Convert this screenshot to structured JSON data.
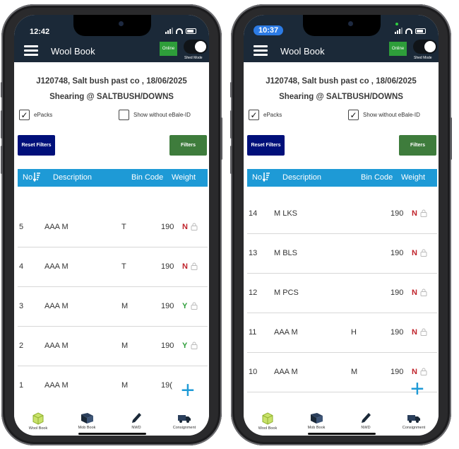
{
  "phones": [
    {
      "status": {
        "time": "12:42"
      },
      "app": {
        "title": "Wool Book",
        "online": "Online",
        "shed_mode": "Shed Mode"
      },
      "job": {
        "line1": "J120748, Salt bush past co , 18/06/2025",
        "line2": "Shearing @ SALTBUSH/DOWNS"
      },
      "filters": {
        "epacks_label": "ePacks",
        "epacks_checked": true,
        "without_ebale_label": "Show without eBale-ID",
        "without_ebale_checked": false,
        "reset_label": "Reset Filters",
        "filters_label": "Filters"
      },
      "table": {
        "headers": {
          "no": "No",
          "description": "Description",
          "bin_code": "Bin Code",
          "weight": "Weight"
        },
        "rows": [
          {
            "no": "5",
            "description": "AAA M",
            "bin": "T",
            "weight": "190",
            "flag": "N"
          },
          {
            "no": "4",
            "description": "AAA M",
            "bin": "T",
            "weight": "190",
            "flag": "N"
          },
          {
            "no": "3",
            "description": "AAA M",
            "bin": "M",
            "weight": "190",
            "flag": "Y"
          },
          {
            "no": "2",
            "description": "AAA M",
            "bin": "M",
            "weight": "190",
            "flag": "Y"
          },
          {
            "no": "1",
            "description": "AAA M",
            "bin": "M",
            "weight": "19(",
            "flag": ""
          }
        ]
      },
      "nav": [
        "Wool Book",
        "Mob Book",
        "NWD",
        "Consignment"
      ]
    },
    {
      "status": {
        "time": "10:37"
      },
      "app": {
        "title": "Wool Book",
        "online": "Online",
        "shed_mode": "Shed Mode"
      },
      "job": {
        "line1": "J120748, Salt bush past co , 18/06/2025",
        "line2": "Shearing @ SALTBUSH/DOWNS"
      },
      "filters": {
        "epacks_label": "ePacks",
        "epacks_checked": true,
        "without_ebale_label": "Show without eBale-ID",
        "without_ebale_checked": true,
        "reset_label": "Reset Filters",
        "filters_label": "Filters"
      },
      "table": {
        "headers": {
          "no": "No",
          "description": "Description",
          "bin_code": "Bin Code",
          "weight": "Weight"
        },
        "rows": [
          {
            "no": "14",
            "description": "M LKS",
            "bin": "",
            "weight": "190",
            "flag": "N"
          },
          {
            "no": "13",
            "description": "M BLS",
            "bin": "",
            "weight": "190",
            "flag": "N"
          },
          {
            "no": "12",
            "description": "M PCS",
            "bin": "",
            "weight": "190",
            "flag": "N"
          },
          {
            "no": "11",
            "description": "AAA M",
            "bin": "H",
            "weight": "190",
            "flag": "N"
          },
          {
            "no": "10",
            "description": "AAA M",
            "bin": "M",
            "weight": "190",
            "flag": "N"
          }
        ]
      },
      "nav": [
        "Wool Book",
        "Mob Book",
        "NWD",
        "Consignment"
      ]
    }
  ],
  "colors": {
    "appbar": "#1b2938",
    "header": "#1e9ad6",
    "reset": "#00107a",
    "filters": "#3e7c3c",
    "online": "#2e9e3a",
    "flag_n": "#c0232b",
    "flag_y": "#2e9e3a"
  }
}
